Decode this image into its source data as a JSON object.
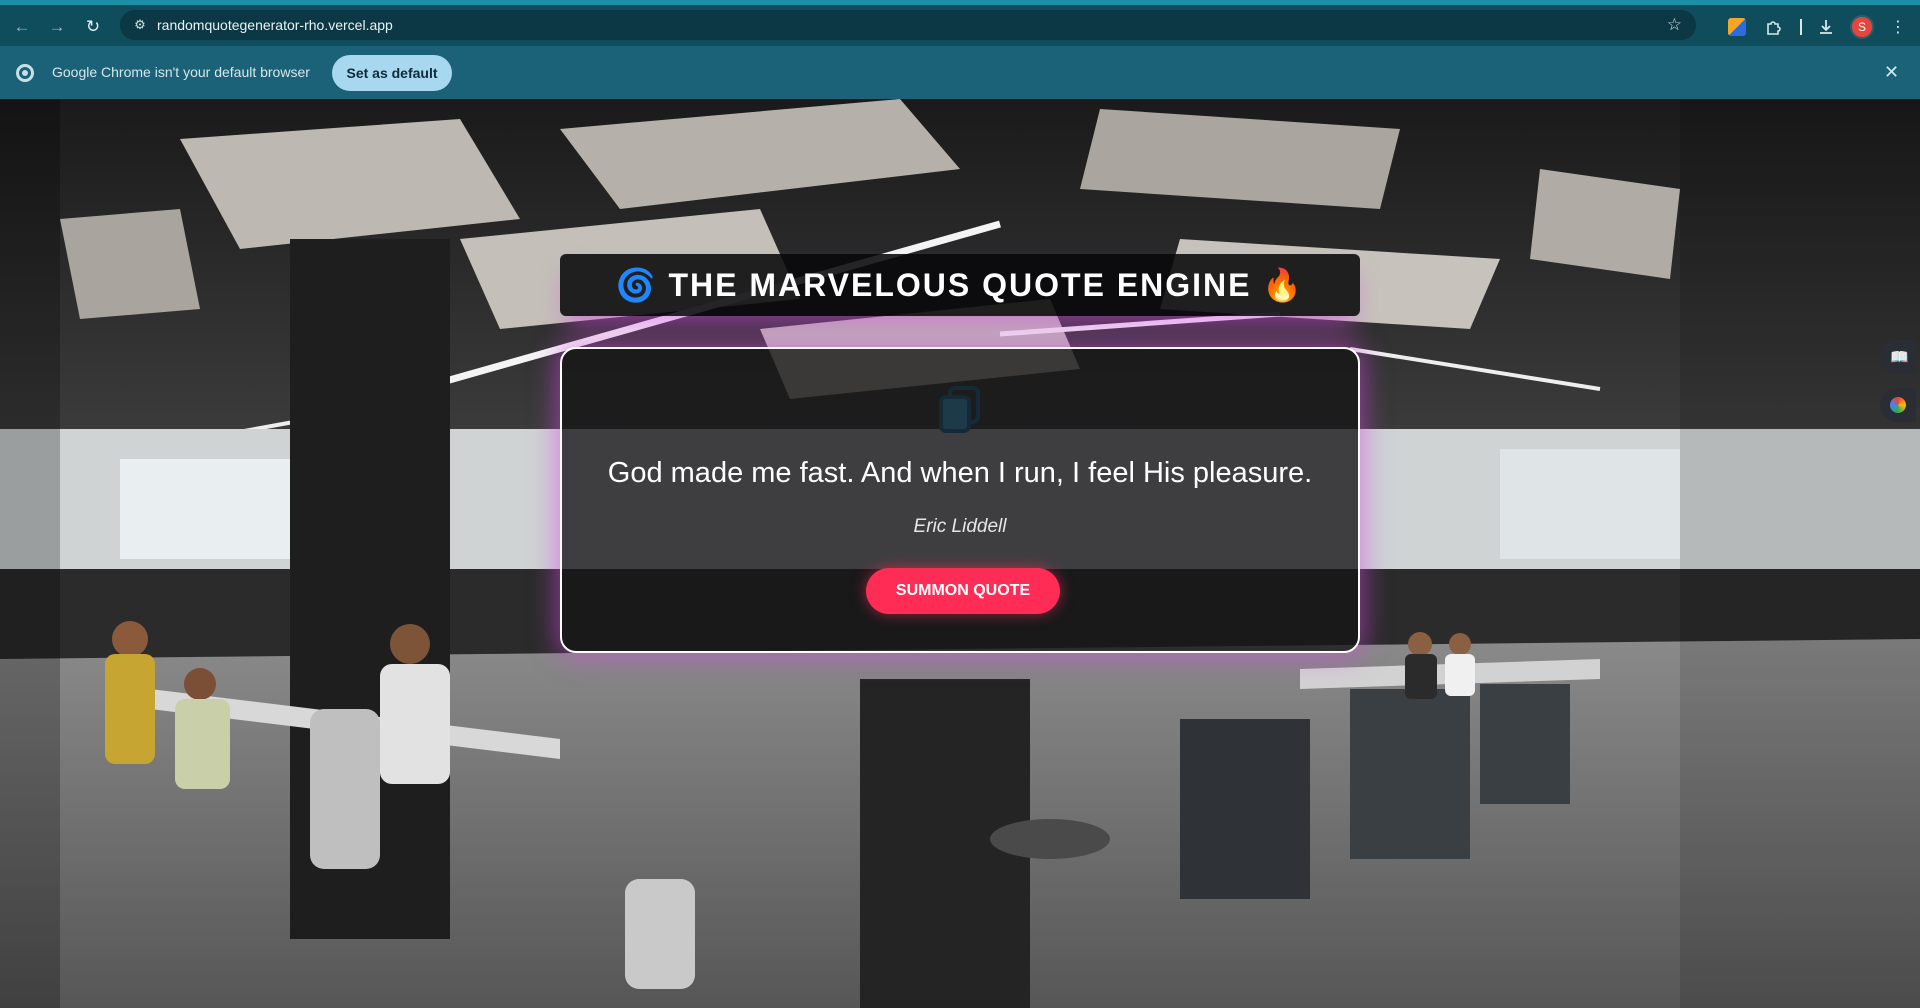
{
  "browser": {
    "url": "randomquotegenerator-rho.vercel.app",
    "avatar_initial": "S",
    "icons": {
      "back": "arrow-left-icon",
      "forward": "arrow-right-icon",
      "reload": "reload-icon",
      "site_info": "site-info-icon",
      "bookmark": "star-icon",
      "extension": "extension-icon",
      "puzzle": "puzzle-icon",
      "download": "download-icon",
      "menu": "kebab-menu-icon"
    }
  },
  "infobar": {
    "message": "Google Chrome isn't your default browser",
    "button_label": "Set as default",
    "close_glyph": "✕"
  },
  "app": {
    "title": "🌀 THE MARVELOUS QUOTE ENGINE 🔥",
    "quote": "God made me fast. And when I run, I feel His pleasure.",
    "author": "Eric Liddell",
    "button_label": "SUMMON QUOTE",
    "accent_color": "#ff2d55",
    "glow_color": "#d648e6"
  }
}
